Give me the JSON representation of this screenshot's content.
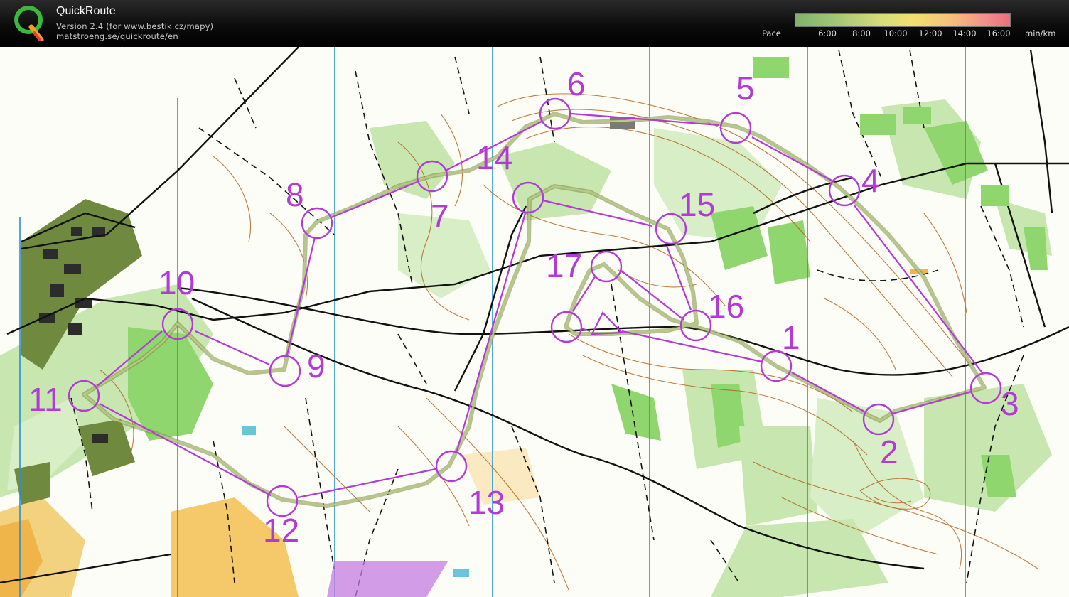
{
  "app": {
    "title": "QuickRoute",
    "subtitle": "Version 2.4  (for www.bestik.cz/mapy)",
    "website": "matstroeng.se/quickroute/en",
    "logo_letter": "Q"
  },
  "pace_legend": {
    "label": "Pace",
    "unit": "min/km",
    "ticks": [
      "6:00",
      "8:00",
      "10:00",
      "12:00",
      "14:00",
      "16:00"
    ],
    "gradient_colors": [
      "#7fb26e",
      "#d6dd7a",
      "#f2df70",
      "#ec6f7f"
    ]
  },
  "course": {
    "color": "#b23bd6",
    "controls": [
      "1",
      "2",
      "3",
      "4",
      "5",
      "6",
      "7",
      "8",
      "9",
      "10",
      "11",
      "12",
      "13",
      "14",
      "15",
      "16",
      "17"
    ]
  },
  "colors": {
    "route": "#9aaa5a",
    "contour": "#b5651d",
    "forest_light": "#c8e6b0",
    "forest_mid": "#8fd66e",
    "meridian": "#2b8fd1"
  }
}
